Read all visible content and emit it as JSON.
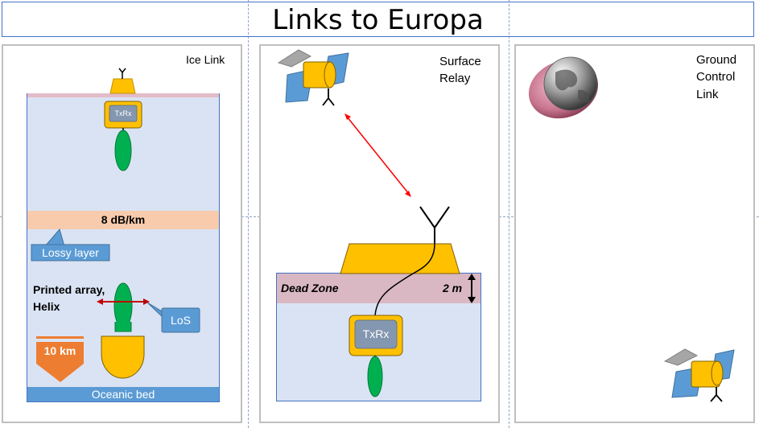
{
  "title": "Links to Europa",
  "panels": {
    "ice": {
      "label": "Ice Link",
      "txrx": "TxRx",
      "attenuation": "8 dB/km",
      "lossy_layer": "Lossy layer",
      "array_label_line1": "Printed array,",
      "array_label_line2": "Helix",
      "los": "LoS",
      "depth": "10 km",
      "seabed": "Oceanic bed"
    },
    "surface": {
      "label_line1": "Surface",
      "label_line2": "Relay",
      "dead_zone": "Dead Zone",
      "thickness": "2 m",
      "txrx": "TxRx"
    },
    "ground": {
      "label_line1": "Ground",
      "label_line2": "Control",
      "label_line3": "Link"
    }
  },
  "colors": {
    "ice": "#dae3f3",
    "ice_border": "#4472c4",
    "lander": "#ffc000",
    "txrx_box": "#8497b0",
    "antenna": "#00b050",
    "lossy_band": "#f8cbad",
    "callout": "#5b9bd5",
    "depth_arrow": "#ed7d31",
    "dead_zone": "#d9b8c4",
    "link_arrow": "#ff0000",
    "los_arrow": "#c00000"
  },
  "icons": [
    "satellite-icon",
    "globe-icon",
    "antenna-icon"
  ]
}
